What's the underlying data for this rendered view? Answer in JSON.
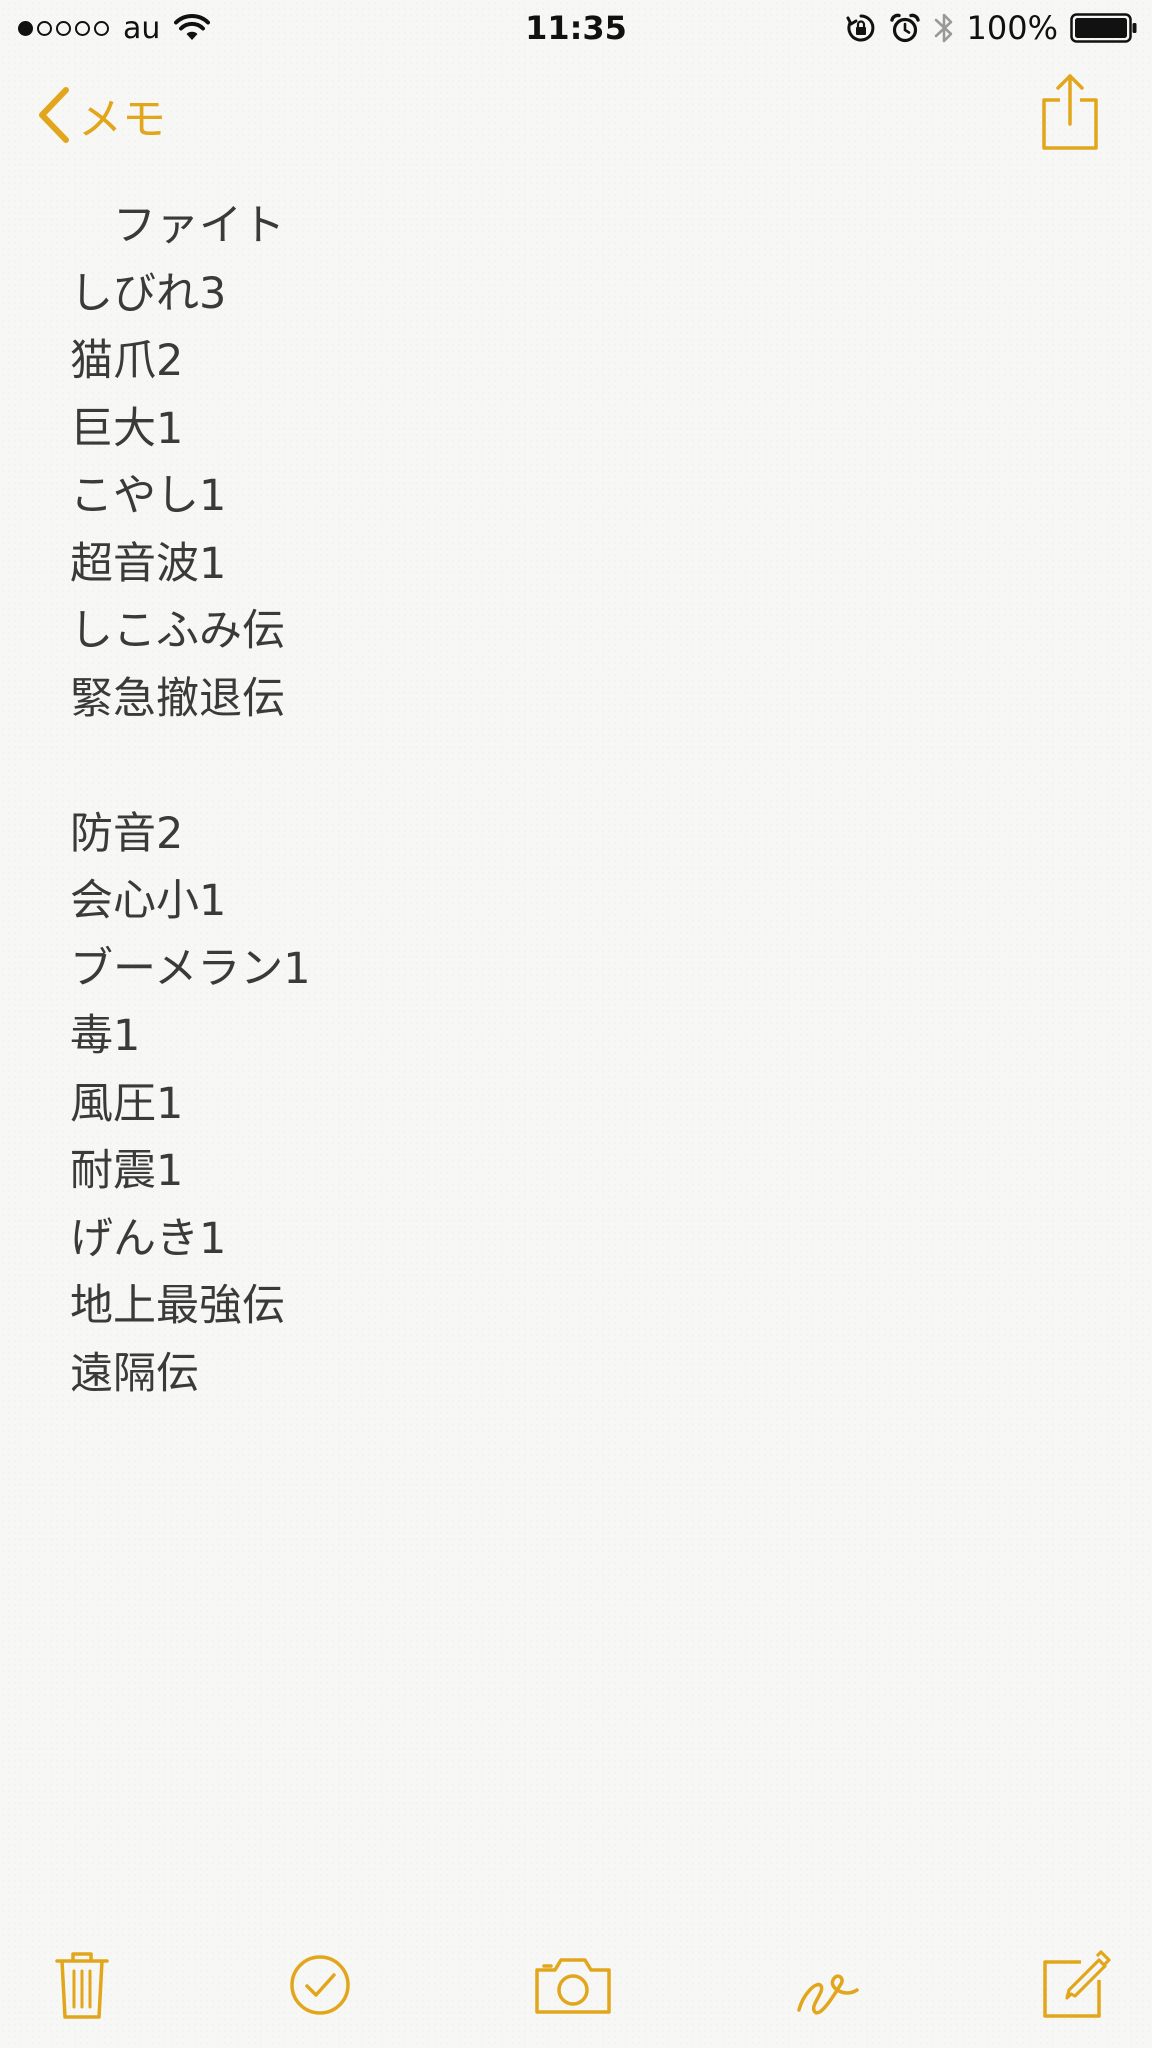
{
  "status_bar": {
    "signal_dots": [
      true,
      false,
      false,
      false,
      false
    ],
    "carrier": "au",
    "time": "11:35",
    "battery_percent": "100%"
  },
  "nav": {
    "back_label": "メモ"
  },
  "note": {
    "lines": [
      "　ファイト",
      "しびれ3",
      "猫爪2",
      "巨大1",
      "こやし1",
      "超音波1",
      "しこふみ伝",
      "緊急撤退伝",
      "",
      "防音2",
      "会心小1",
      "ブーメラン1",
      "毒1",
      "風圧1",
      "耐震1",
      "げんき1",
      "地上最強伝",
      "遠隔伝"
    ]
  },
  "toolbar": {
    "items": [
      "trash-icon",
      "checklist-icon",
      "camera-icon",
      "sketch-icon",
      "compose-icon"
    ]
  },
  "colors": {
    "accent": "#e2a61c",
    "text": "#3a3a3a",
    "background": "#f7f7f5"
  }
}
